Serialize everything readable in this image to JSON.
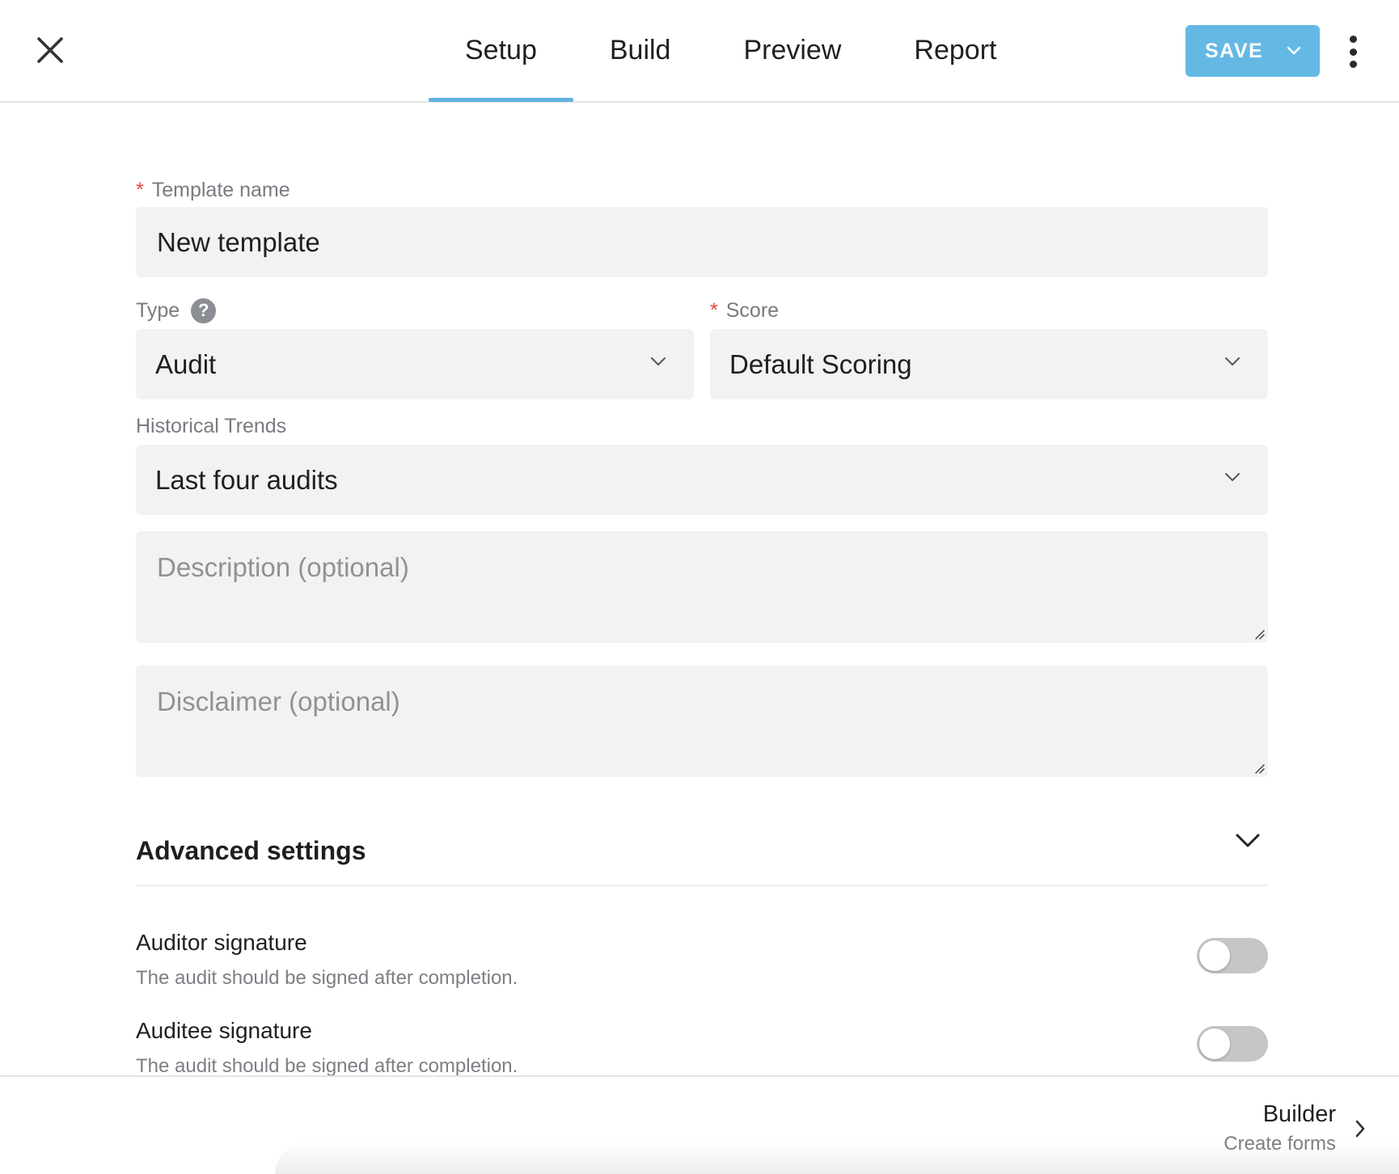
{
  "header": {
    "tabs": [
      {
        "label": "Setup",
        "active": true
      },
      {
        "label": "Build",
        "active": false
      },
      {
        "label": "Preview",
        "active": false
      },
      {
        "label": "Report",
        "active": false
      }
    ],
    "save_label": "SAVE",
    "accent_color": "#5fb3e0"
  },
  "form": {
    "template_name": {
      "label": "Template name",
      "required_mark": "*",
      "value": "New template"
    },
    "type": {
      "label": "Type",
      "help": "?",
      "value": "Audit"
    },
    "score": {
      "label": "Score",
      "required_mark": "*",
      "value": "Default Scoring"
    },
    "historical_trends": {
      "label": "Historical Trends",
      "value": "Last four audits"
    },
    "description": {
      "placeholder": "Description (optional)"
    },
    "disclaimer": {
      "placeholder": "Disclaimer (optional)"
    }
  },
  "advanced": {
    "title": "Advanced settings",
    "toggles": [
      {
        "title": "Auditor signature",
        "description": "The audit should be signed after completion.",
        "on": false
      },
      {
        "title": "Auditee signature",
        "description": "The audit should be signed after completion.",
        "on": false
      }
    ]
  },
  "footer": {
    "next_title": "Builder",
    "next_subtitle": "Create forms"
  }
}
